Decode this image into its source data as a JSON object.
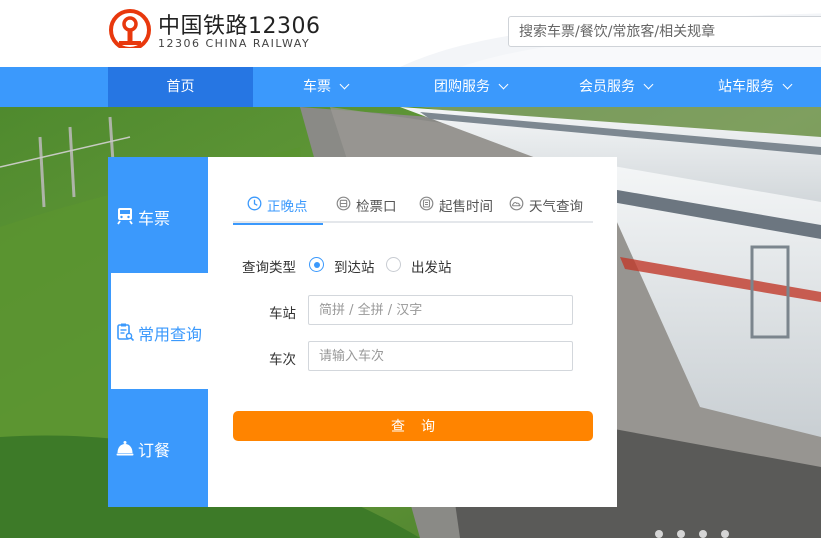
{
  "header": {
    "brand_cn": "中国铁路12306",
    "brand_en": "12306 CHINA RAILWAY",
    "search_placeholder": "搜索车票/餐饮/常旅客/相关规章",
    "brand_color": "#e8380d"
  },
  "nav": {
    "items": [
      {
        "label": "首页",
        "active": true
      },
      {
        "label": "车票",
        "dropdown": true
      },
      {
        "label": "团购服务",
        "dropdown": true
      },
      {
        "label": "会员服务",
        "dropdown": true
      },
      {
        "label": "站车服务",
        "dropdown": true
      }
    ],
    "color": "#3b99fc",
    "active_color": "#2676e3"
  },
  "side_tabs": [
    {
      "label": "车票",
      "icon": "train-icon"
    },
    {
      "label": "常用查询",
      "icon": "clipboard-search-icon",
      "active": true
    },
    {
      "label": "订餐",
      "icon": "food-cloche-icon"
    }
  ],
  "sub_tabs": [
    {
      "label": "正晚点",
      "icon": "clock-icon",
      "active": true
    },
    {
      "label": "检票口",
      "icon": "ticket-gate-icon"
    },
    {
      "label": "起售时间",
      "icon": "sale-time-icon"
    },
    {
      "label": "天气查询",
      "icon": "weather-icon"
    }
  ],
  "form": {
    "query_type_label": "查询类型",
    "query_type_options": [
      {
        "label": "到达站",
        "checked": true
      },
      {
        "label": "出发站",
        "checked": false
      }
    ],
    "station_label": "车站",
    "station_placeholder": "简拼 / 全拼 / 汉字",
    "train_label": "车次",
    "train_placeholder": "请输入车次",
    "submit_label": "查询",
    "submit_color": "#ff8400"
  }
}
